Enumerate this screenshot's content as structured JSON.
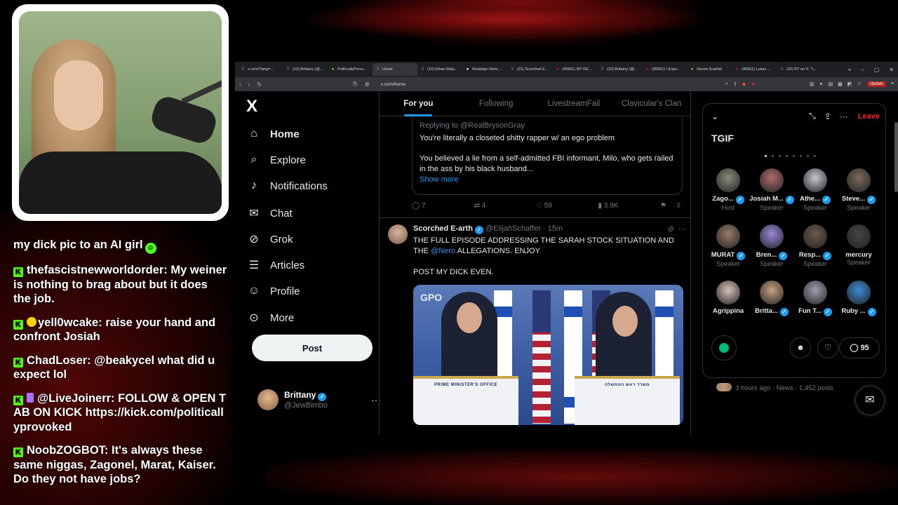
{
  "chat": {
    "partial_line": "",
    "m1_text": "my dick pic to an AI girl",
    "m2_user": "thefascistnewworldorder:",
    "m2_text": "My weiner is nothing to brag about but it does the job.",
    "m3_user": "yell0wcake:",
    "m3_text": "raise your hand and confront Josiah",
    "m4_user": "ChadLoser:",
    "m4_text": "@beakycel what did u expect lol",
    "m5_user": "@LiveJoinerr:",
    "m5_text": "FOLLOW & OPEN TAB ON KICK https://kick.com/politicallyprovoked",
    "m6_user": "NoobZOGBOT:",
    "m6_text": "It's always these same niggas, Zagonel, Marat, Kaiser. Do they not have jobs?"
  },
  "browser": {
    "tabs": [
      {
        "label": "x.com/?lang=...",
        "icon": "x-icon",
        "color": "#888"
      },
      {
        "label": "(13) Brittany (@...",
        "icon": "x-icon",
        "color": "#888"
      },
      {
        "label": "PoliticallyProvo...",
        "icon": "kick-icon",
        "color": "#53fc18"
      },
      {
        "label": "Home",
        "icon": "x-icon",
        "color": "#888",
        "active": true
      },
      {
        "label": "(10) Ethan Ralp...",
        "icon": "x-icon",
        "color": "#888"
      },
      {
        "label": "Nostalgic Mem...",
        "icon": "tiktok-icon",
        "color": "#fff"
      },
      {
        "label": "(21) Scorched E...",
        "icon": "x-icon",
        "color": "#888"
      },
      {
        "label": "(45561) MY RE...",
        "icon": "youtube-icon",
        "color": "#f00"
      },
      {
        "label": "(20) Brittany (@...",
        "icon": "x-icon",
        "color": "#888"
      },
      {
        "label": "(45561) I Expo...",
        "icon": "youtube-icon",
        "color": "#f00"
      },
      {
        "label": "Secret Scarlett",
        "icon": "rumble-icon",
        "color": "#85c742"
      },
      {
        "label": "(45561) Lukas ...",
        "icon": "youtube-icon",
        "color": "#f00"
      },
      {
        "label": "(20) RT on X: \"I...",
        "icon": "x-icon",
        "color": "#888"
      }
    ],
    "url": "x.com/home",
    "update_label": "Update"
  },
  "nav": {
    "logo": "X",
    "items": [
      {
        "label": "Home",
        "icon": "home-icon"
      },
      {
        "label": "Explore",
        "icon": "search-icon"
      },
      {
        "label": "Notifications",
        "icon": "bell-icon"
      },
      {
        "label": "Chat",
        "icon": "mail-icon"
      },
      {
        "label": "Grok",
        "icon": "grok-icon"
      },
      {
        "label": "Articles",
        "icon": "article-icon"
      },
      {
        "label": "Profile",
        "icon": "person-icon"
      },
      {
        "label": "More",
        "icon": "more-circle-icon"
      }
    ],
    "post_label": "Post",
    "account_name": "Brittany",
    "account_handle": "@JewBimbo"
  },
  "feed": {
    "tabs": [
      "For you",
      "Following",
      "LivestreamFail",
      "Clavicular's Clan"
    ],
    "quote": {
      "replying_to": "Replying to @RealBrysonGray",
      "line1": "You're literally a closeted shitty rapper w/ an ego problem",
      "line2": "You believed a lie from a self-admitted FBI informant, Milo, who gets railed in the ass by his black husband...",
      "show_more": "Show more"
    },
    "actions1": {
      "replies": "7",
      "reposts": "4",
      "likes": "59",
      "views": "3.9K"
    },
    "tweet2": {
      "name": "Scorched E-arth",
      "handle": "@ElijahSchaffer · 15m",
      "body_a": "THE FULL EPISODE ADDRESSING THE SARAH STOCK SITUATION AND THE ",
      "mention": "@Nero",
      "body_b": " ALLEGATIONS. ENJOY",
      "body_c": "POST MY DICK EVEN.",
      "media_left_podium": "PRIME MINISTER'S OFFICE",
      "media_right_podium": "משרד ראש הממשלה",
      "media_watermark": "GPO"
    }
  },
  "space": {
    "leave_label": "Leave",
    "title": "TGIF",
    "speakers": [
      {
        "name": "Zago...",
        "role": "Host",
        "verified": true,
        "color": "#8a8a7a"
      },
      {
        "name": "Josiah M...",
        "role": "Speaker",
        "verified": true,
        "color": "#b06a6a"
      },
      {
        "name": "Athe...",
        "role": "Speaker",
        "verified": true,
        "color": "#c8c8d0"
      },
      {
        "name": "Steve...",
        "role": "Speaker",
        "verified": true,
        "color": "#7a6a5a"
      },
      {
        "name": "MURAT",
        "role": "Speaker",
        "verified": true,
        "color": "#9a7a6a"
      },
      {
        "name": "Bren...",
        "role": "Speaker",
        "verified": true,
        "color": "#9a88d8"
      },
      {
        "name": "Resp...",
        "role": "Speaker",
        "verified": true,
        "color": "#6a5a4a"
      },
      {
        "name": "mercury",
        "role": "Speaker",
        "verified": false,
        "color": "#444"
      },
      {
        "name": "Agrippina",
        "role": "",
        "verified": false,
        "color": "#d8c0b8"
      },
      {
        "name": "Britta...",
        "role": "",
        "verified": true,
        "color": "#c8a080"
      },
      {
        "name": "Fun T...",
        "role": "",
        "verified": true,
        "color": "#a0a0b0"
      },
      {
        "name": "Ruby ...",
        "role": "",
        "verified": true,
        "color": "#3a8ad8"
      }
    ],
    "reply_count": "95"
  },
  "trend": {
    "text": "3 hours ago · News · 1,452 posts"
  }
}
